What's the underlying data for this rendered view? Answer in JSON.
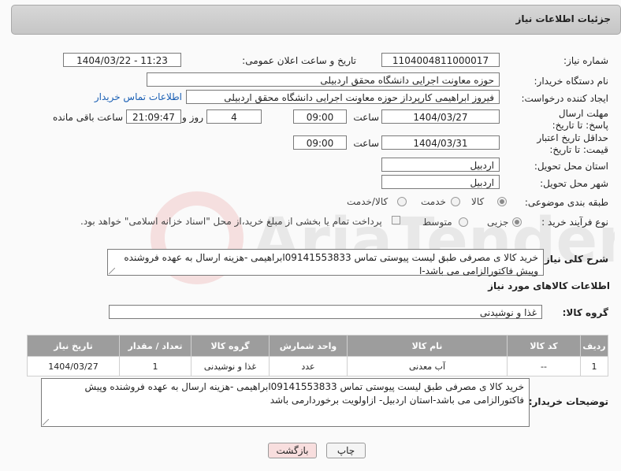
{
  "header": {
    "title": "جزئیات اطلاعات نیاز"
  },
  "need_number": {
    "label": "شماره نیاز:",
    "value": "1104004811000017"
  },
  "announce": {
    "label": "تاریخ و ساعت اعلان عمومی:",
    "value": "1404/03/22 - 11:23"
  },
  "buyer_org": {
    "label": "نام دستگاه خریدار:",
    "value": "حوزه معاونت اجرایی دانشگاه محقق اردبیلی"
  },
  "requester": {
    "label": "ایجاد کننده درخواست:",
    "value": "فیروز ابراهیمی کارپرداز حوزه معاونت اجرایی دانشگاه محقق اردبیلی",
    "contact_link": "اطلاعات تماس خریدار"
  },
  "deadline": {
    "label": "مهلت ارسال پاسخ: تا تاریخ:",
    "date": "1404/03/27",
    "time_label": "ساعت",
    "time": "09:00",
    "days": "4",
    "days_label": "روز و",
    "remaining": "21:09:47",
    "remaining_label": "ساعت باقی مانده"
  },
  "validity": {
    "label": "حداقل تاریخ اعتبار قیمت: تا تاریخ:",
    "date": "1404/03/31",
    "time_label": "ساعت",
    "time": "09:00"
  },
  "province": {
    "label": "استان محل تحویل:",
    "value": "اردبیل"
  },
  "city": {
    "label": "شهر محل تحویل:",
    "value": "اردبیل"
  },
  "category": {
    "label": "طبقه بندی موضوعی:",
    "options": [
      "کالا",
      "خدمت",
      "کالا/خدمت"
    ],
    "selected": "کالا"
  },
  "process": {
    "label": "نوع فرآیند خرید :",
    "options": [
      "جزیی",
      "متوسط"
    ],
    "selected": "جزیی",
    "note": "پرداخت تمام یا بخشی از مبلغ خرید،از محل \"اسناد خزانه اسلامی\" خواهد بود."
  },
  "description": {
    "label": "شرح کلی نیاز:",
    "text": "خرید کالا ی مصرفی طبق لیست پیوستی تماس 09141553833ابراهیمی -هزینه ارسال به عهده فروشنده وپیش فاکتورالزامی می باشد-ا"
  },
  "goods_section": {
    "title": "اطلاعات کالاهای مورد نیاز"
  },
  "goods_group": {
    "label": "گروه کالا:",
    "value": "غذا و نوشیدنی"
  },
  "table": {
    "headers": [
      "ردیف",
      "کد کالا",
      "نام کالا",
      "واحد شمارش",
      "گروه کالا",
      "تعداد / مقدار",
      "تاریخ نیاز"
    ],
    "rows": [
      [
        "1",
        "--",
        "آب معدنی",
        "عدد",
        "غذا و نوشیدنی",
        "1",
        "1404/03/27"
      ]
    ]
  },
  "buyer_notes": {
    "label": "توضیحات خریدار:",
    "text": "خرید کالا ی مصرفی طبق لیست پیوستی تماس 09141553833ابراهیمی -هزینه ارسال به عهده فروشنده وپیش فاکتورالزامی می باشد-استان اردبیل- ازاولویت برخوردارمی باشد"
  },
  "buttons": {
    "print": "چاپ",
    "back": "بازگشت"
  },
  "watermark": {
    "text": "AriaTender.neT"
  },
  "colors": {
    "link": "#1a5fb4",
    "table_header": "#9d9d9d",
    "back_button": "#f8dede"
  }
}
